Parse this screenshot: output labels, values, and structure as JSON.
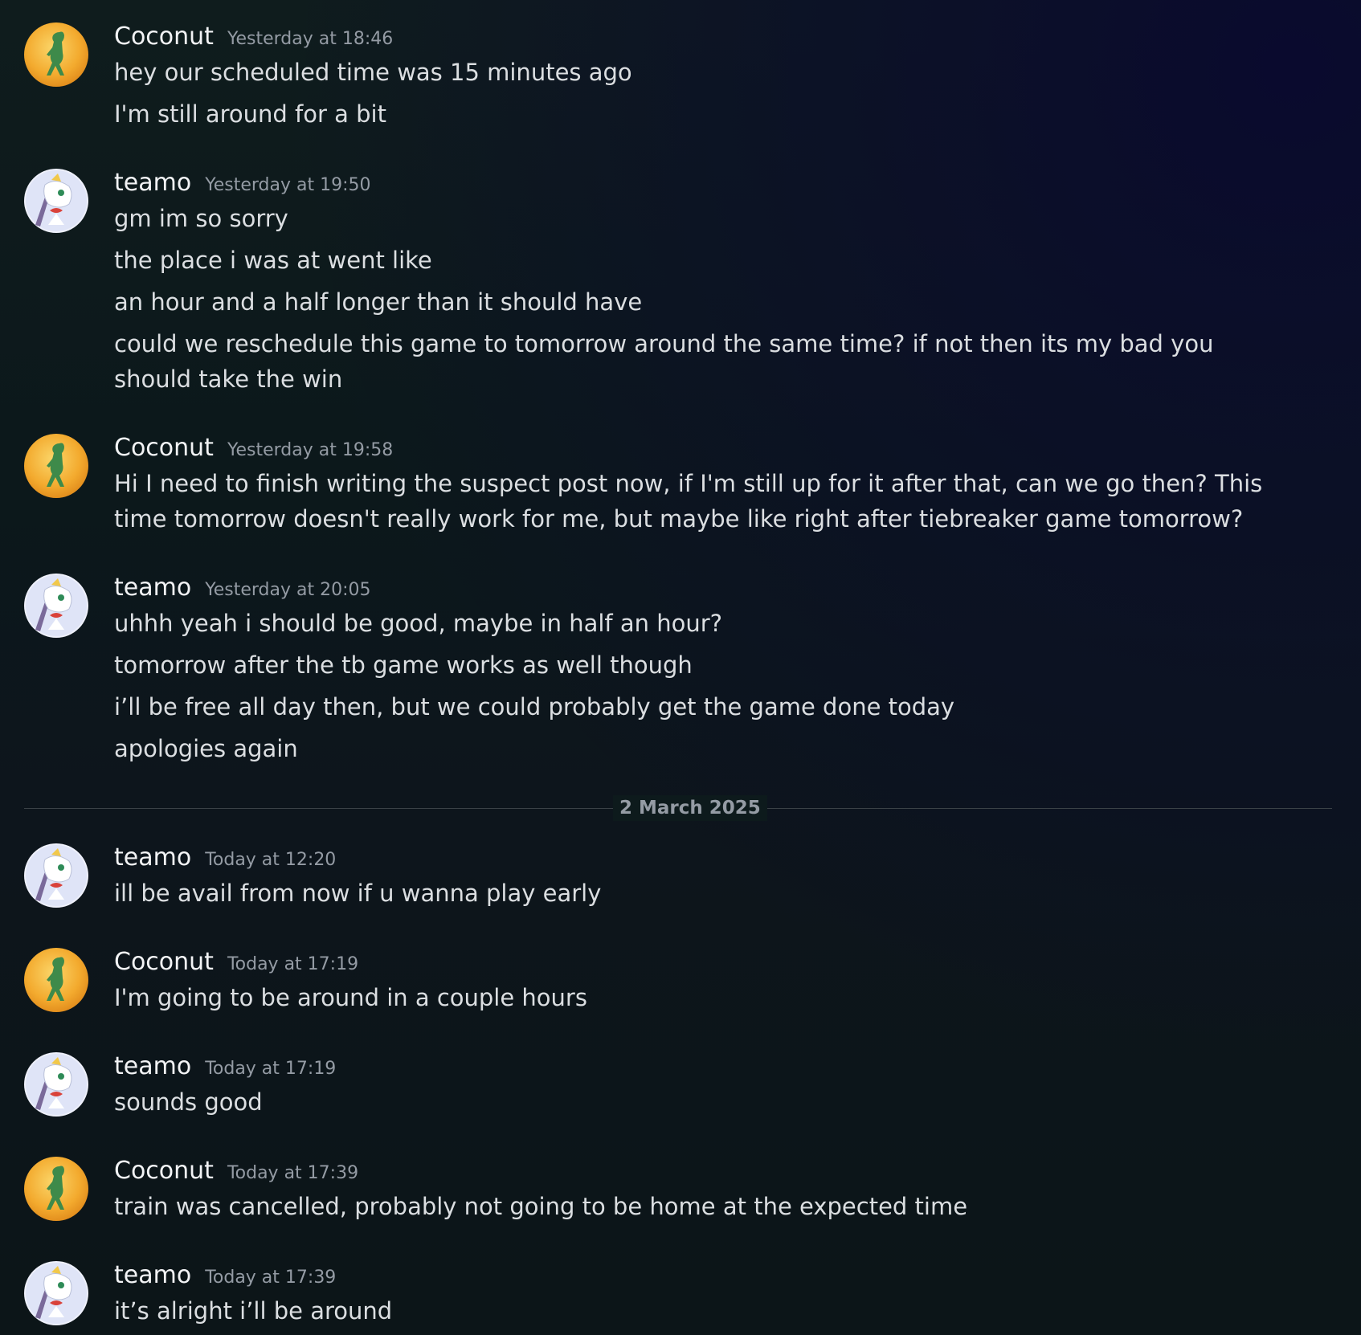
{
  "messages_before_divider": [
    {
      "author": "Coconut",
      "avatar_icon": "coconut-avatar",
      "timestamp": "Yesterday at 18:46",
      "lines": [
        "hey our scheduled time was 15 minutes ago",
        "I'm still around for a bit"
      ]
    },
    {
      "author": "teamo",
      "avatar_icon": "teamo-avatar",
      "timestamp": "Yesterday at 19:50",
      "lines": [
        "gm im so sorry",
        "the place i was at went like",
        "an hour and a half longer than it should have",
        "could we reschedule this game to tomorrow around the same time? if not then its my bad you should take the win"
      ]
    },
    {
      "author": "Coconut",
      "avatar_icon": "coconut-avatar",
      "timestamp": "Yesterday at 19:58",
      "lines": [
        "Hi I need to finish writing the suspect post now, if I'm still up for it after that, can we go then? This time tomorrow doesn't really work for me, but maybe like right after tiebreaker game tomorrow?"
      ]
    },
    {
      "author": "teamo",
      "avatar_icon": "teamo-avatar",
      "timestamp": "Yesterday at 20:05",
      "lines": [
        "uhhh yeah i should be good, maybe in half an hour?",
        "tomorrow after the tb game works as well though",
        "i’ll be free all day then, but we could probably get the game done today",
        "apologies again"
      ]
    }
  ],
  "date_divider": "2 March 2025",
  "messages_after_divider": [
    {
      "author": "teamo",
      "avatar_icon": "teamo-avatar",
      "timestamp": "Today at 12:20",
      "lines": [
        "ill be avail from now if u wanna play early"
      ]
    },
    {
      "author": "Coconut",
      "avatar_icon": "coconut-avatar",
      "timestamp": "Today at 17:19",
      "lines": [
        "I'm going to be around in a couple hours"
      ]
    },
    {
      "author": "teamo",
      "avatar_icon": "teamo-avatar",
      "timestamp": "Today at 17:19",
      "lines": [
        "sounds good"
      ]
    },
    {
      "author": "Coconut",
      "avatar_icon": "coconut-avatar",
      "timestamp": "Today at 17:39",
      "lines": [
        "train was cancelled, probably not going to be home at the expected time"
      ]
    },
    {
      "author": "teamo",
      "avatar_icon": "teamo-avatar",
      "timestamp": "Today at 17:39",
      "lines": [
        "it’s alright i’ll be around"
      ]
    }
  ],
  "colors": {
    "username": "#f2f3f5",
    "timestamp": "#949ba4",
    "message_text": "#dbdee1",
    "coconut_avatar_bg": "#f5b63a",
    "teamo_avatar_bg": "#eef0fb"
  }
}
